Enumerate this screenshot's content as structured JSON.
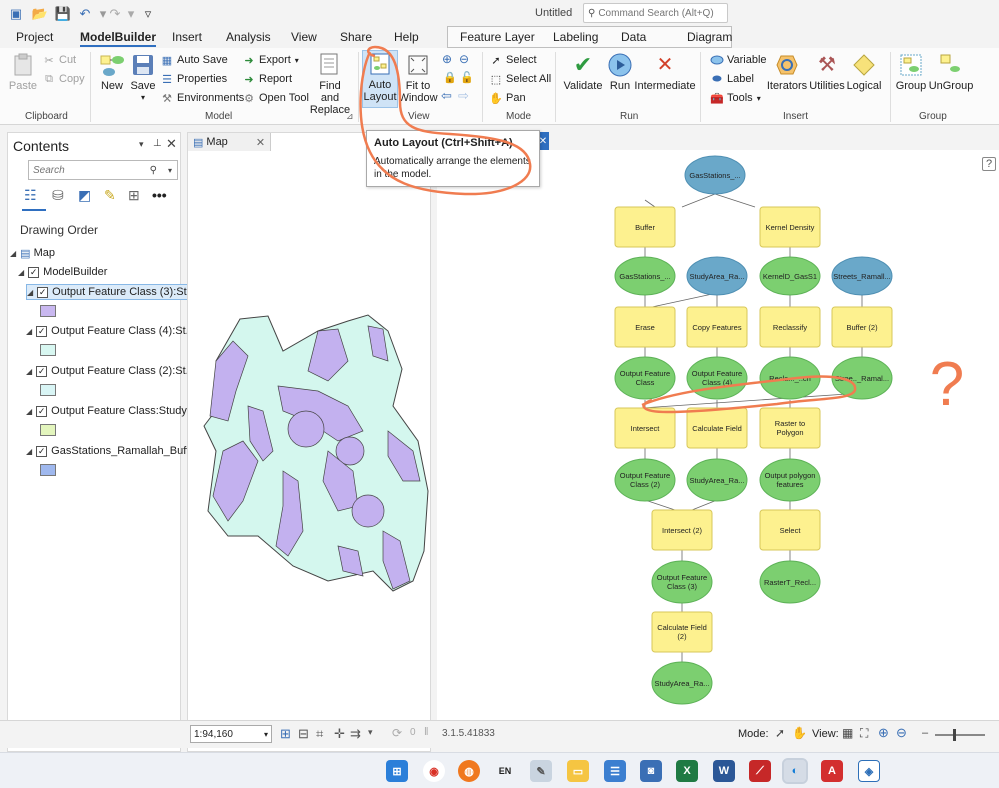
{
  "window": {
    "title": "Untitled",
    "command_search_placeholder": "Command Search (Alt+Q)"
  },
  "menu": {
    "tabs": [
      "Project",
      "ModelBuilder",
      "Insert",
      "Analysis",
      "View",
      "Share",
      "Help"
    ],
    "active": "ModelBuilder",
    "context_tabs": [
      "Feature Layer",
      "Labeling",
      "Data"
    ],
    "diagram_tab": "Diagram"
  },
  "ribbon": {
    "clipboard": {
      "paste": "Paste",
      "cut": "Cut",
      "copy": "Copy",
      "label": "Clipboard"
    },
    "model": {
      "new": "New",
      "save": "Save",
      "auto_save": "Auto Save",
      "properties": "Properties",
      "environments": "Environments",
      "export": "Export",
      "report": "Report",
      "open_tool": "Open Tool",
      "find_replace_1": "Find and",
      "find_replace_2": "Replace",
      "label": "Model"
    },
    "view": {
      "auto_layout_1": "Auto",
      "auto_layout_2": "Layout",
      "fit_1": "Fit to",
      "fit_2": "Window",
      "label": "View"
    },
    "mode": {
      "select": "Select",
      "select_all": "Select All",
      "pan": "Pan",
      "label": "Mode"
    },
    "run": {
      "validate": "Validate",
      "run": "Run",
      "intermediate": "Intermediate",
      "label": "Run"
    },
    "insert": {
      "variable": "Variable",
      "label_btn": "Label",
      "tools": "Tools",
      "iterators": "Iterators",
      "utilities": "Utilities",
      "logical": "Logical",
      "label": "Insert"
    },
    "group": {
      "group": "Group",
      "ungroup": "UnGroup",
      "label": "Group"
    }
  },
  "tooltip": {
    "title": "Auto Layout (Ctrl+Shift+A)",
    "body_1": "Automatically arrange the elements",
    "body_2": "in the model."
  },
  "contents": {
    "title": "Contents",
    "search_placeholder": "Search",
    "drawing_order": "Drawing Order",
    "map": "Map",
    "model_builder": "ModelBuilder",
    "layers": [
      {
        "name": "Output Feature Class (3):St...",
        "color": "#c9b8f0"
      },
      {
        "name": "Output Feature Class (4):St...",
        "color": "#d8f7f1"
      },
      {
        "name": "Output Feature Class (2):St...",
        "color": "#d9f5f5"
      },
      {
        "name": "Output Feature Class:Study...",
        "color": "#e3f5bd"
      },
      {
        "name": "GasStations_Ramallah_Buff...",
        "color": "#9fb8ee"
      }
    ]
  },
  "map_tab": {
    "label": "Map"
  },
  "model": {
    "nodes": [
      {
        "id": "gas",
        "label": "GasStations_...",
        "type": "blue"
      },
      {
        "id": "buffer",
        "label": "Buffer",
        "type": "tool"
      },
      {
        "id": "kd",
        "label": "Kernel Density",
        "type": "tool"
      },
      {
        "id": "gasout",
        "label": "GasStations_...",
        "type": "green"
      },
      {
        "id": "study1",
        "label": "StudyArea_Ra...",
        "type": "blue"
      },
      {
        "id": "kdout",
        "label": "KernelD_GasS1",
        "type": "green"
      },
      {
        "id": "streets",
        "label": "Streets_Ramall...",
        "type": "blue"
      },
      {
        "id": "erase",
        "label": "Erase",
        "type": "tool"
      },
      {
        "id": "copy",
        "label": "Copy Features",
        "type": "tool"
      },
      {
        "id": "reclass",
        "label": "Reclassify",
        "type": "tool"
      },
      {
        "id": "buffer2",
        "label": "Buffer (2)",
        "type": "tool"
      },
      {
        "id": "ofc",
        "label": "Output Feature|Class",
        "type": "green"
      },
      {
        "id": "ofcb",
        "label": "Output Feature|Class (4)",
        "type": "green"
      },
      {
        "id": "recl",
        "label": "Recla..._..cn",
        "type": "green"
      },
      {
        "id": "strout",
        "label": "Stree.._Ramal...",
        "type": "green"
      },
      {
        "id": "intersect",
        "label": "Intersect",
        "type": "tool"
      },
      {
        "id": "calc",
        "label": "Calculate Field",
        "type": "tool"
      },
      {
        "id": "r2p",
        "label": "Raster to|Polygon",
        "type": "tool"
      },
      {
        "id": "ofc2",
        "label": "Output Feature|Class (2)",
        "type": "green"
      },
      {
        "id": "study2",
        "label": "StudyArea_Ra...",
        "type": "green"
      },
      {
        "id": "opf",
        "label": "Output polygon|features",
        "type": "green"
      },
      {
        "id": "int2",
        "label": "Intersect (2)",
        "type": "tool"
      },
      {
        "id": "sel",
        "label": "Select",
        "type": "tool"
      },
      {
        "id": "ofc3",
        "label": "Output Feature|Class (3)",
        "type": "green"
      },
      {
        "id": "rastert",
        "label": "RasterT_Recl...",
        "type": "green"
      },
      {
        "id": "calc2",
        "label": "Calculate Field|(2)",
        "type": "tool"
      },
      {
        "id": "study3",
        "label": "StudyArea_Ra...",
        "type": "green"
      }
    ],
    "annotation_question": "?"
  },
  "status": {
    "scale": "1:94,160",
    "zero": "0",
    "version": "3.1.5.41833",
    "mode_label": "Mode:",
    "view_label": "View:"
  },
  "taskbar": {
    "lang": "EN"
  },
  "colors": {
    "tool": "#fdf18f",
    "input": "#6aa8c9",
    "output": "#7ccf70",
    "annotation": "#f07c50",
    "map_fill": "#d4f7ee",
    "map_overlay": "#c3b1ef"
  }
}
